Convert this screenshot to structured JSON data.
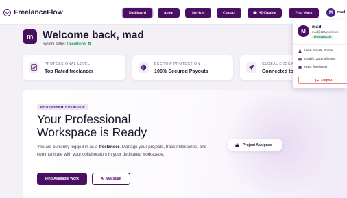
{
  "brand": {
    "name": "FreelanceFlow",
    "icon": "check-circle-icon"
  },
  "nav": {
    "items": [
      {
        "label": "Dashboard",
        "active": true
      },
      {
        "label": "About",
        "active": false
      },
      {
        "label": "Services",
        "active": false
      },
      {
        "label": "Contact",
        "active": false
      },
      {
        "label": "AI Chatbot",
        "active": false,
        "icon": "chat-bubble-icon"
      },
      {
        "label": "Find Work",
        "active": false
      }
    ],
    "user": {
      "initial": "M",
      "name": "mad"
    }
  },
  "welcome": {
    "initial": "m",
    "title": "Welcome back, mad",
    "status_label": "System status:",
    "status_value": "Operational"
  },
  "stats": [
    {
      "label": "PROFESSIONAL LEVEL",
      "value": "Top Rated freelancer",
      "icon": "chart-icon"
    },
    {
      "label": "ESCROW PROTECTION",
      "value": "100% Secured Payouts",
      "icon": "shield-icon"
    },
    {
      "label": "GLOBAL ECOSYSTEM",
      "value": "Connected to",
      "icon": "rocket-icon"
    }
  ],
  "hero": {
    "eyebrow": "ECOSYSTEM OVERVIEW",
    "title_line1": "Your Professional",
    "title_line2": "Workspace is Ready",
    "desc_before": "You are currently logged in as a ",
    "desc_role": "freelancer",
    "desc_after": ". Manage your projects, track milestones, and communicate with your collaborators in your dedicated workspace.",
    "primary_button": "Find Available Work",
    "secondary_button": "AI Assistant",
    "float_card": "Project Assigned"
  },
  "dropdown": {
    "initial": "M",
    "name": "mad",
    "email": "mad@123gmail.com",
    "role_badge": "FREELANCER",
    "items": [
      {
        "label": "View Private Profile",
        "icon": "user-icon"
      },
      {
        "label": "mad@123gmail.com",
        "icon": "mail-icon"
      },
      {
        "label": "Role: freelancer",
        "icon": "id-badge-icon"
      }
    ],
    "logout": "Logout"
  },
  "colors": {
    "primary": "#4a0f62",
    "background": "#f3f0f6",
    "success": "#1f9b57",
    "danger": "#c73838"
  }
}
